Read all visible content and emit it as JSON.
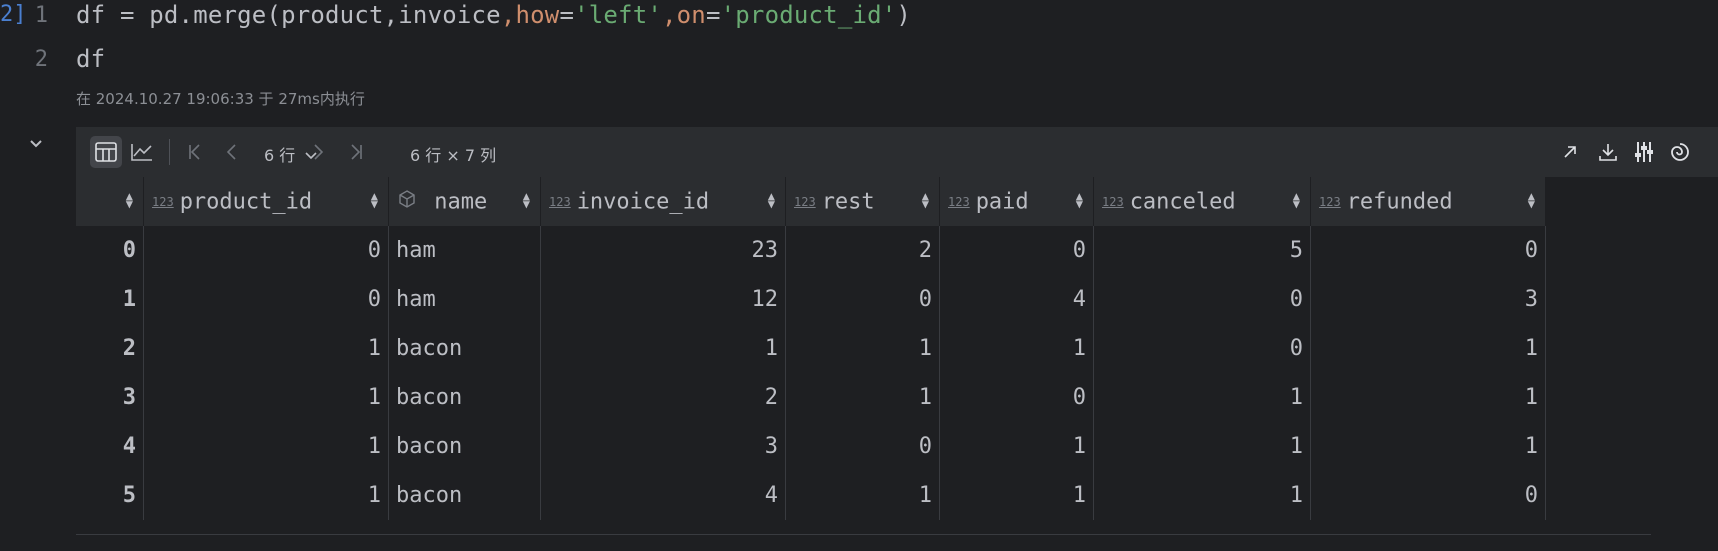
{
  "cell_marker": "2]",
  "code_lines": [
    {
      "num": "1",
      "parts": [
        {
          "t": "df = pd.merge(product,invoice",
          "c": ""
        },
        {
          "t": ",",
          "c": "kw"
        },
        {
          "t": "how",
          "c": "kw"
        },
        {
          "t": "=",
          "c": ""
        },
        {
          "t": "'left'",
          "c": "str"
        },
        {
          "t": ",",
          "c": "kw"
        },
        {
          "t": "on",
          "c": "kw"
        },
        {
          "t": "=",
          "c": ""
        },
        {
          "t": "'product_id'",
          "c": "str"
        },
        {
          "t": ")",
          "c": ""
        }
      ]
    },
    {
      "num": "2",
      "parts": [
        {
          "t": "df",
          "c": ""
        }
      ]
    }
  ],
  "execution_meta": "在 2024.10.27 19:06:33 于 27ms内执行",
  "toolbar": {
    "rows_selector": "6 行",
    "dimensions": "6 行 × 7 列"
  },
  "table": {
    "columns": [
      {
        "name": "product_id",
        "type": "123"
      },
      {
        "name": "name",
        "type": "object"
      },
      {
        "name": "invoice_id",
        "type": "123"
      },
      {
        "name": "rest",
        "type": "123"
      },
      {
        "name": "paid",
        "type": "123"
      },
      {
        "name": "canceled",
        "type": "123"
      },
      {
        "name": "refunded",
        "type": "123"
      }
    ],
    "rows": [
      {
        "index": "0",
        "cells": [
          "0",
          "ham",
          "23",
          "2",
          "0",
          "5",
          "0"
        ]
      },
      {
        "index": "1",
        "cells": [
          "0",
          "ham",
          "12",
          "0",
          "4",
          "0",
          "3"
        ]
      },
      {
        "index": "2",
        "cells": [
          "1",
          "bacon",
          "1",
          "1",
          "1",
          "0",
          "1"
        ]
      },
      {
        "index": "3",
        "cells": [
          "1",
          "bacon",
          "2",
          "1",
          "0",
          "1",
          "1"
        ]
      },
      {
        "index": "4",
        "cells": [
          "1",
          "bacon",
          "3",
          "0",
          "1",
          "1",
          "1"
        ]
      },
      {
        "index": "5",
        "cells": [
          "1",
          "bacon",
          "4",
          "1",
          "1",
          "1",
          "0"
        ]
      }
    ]
  }
}
